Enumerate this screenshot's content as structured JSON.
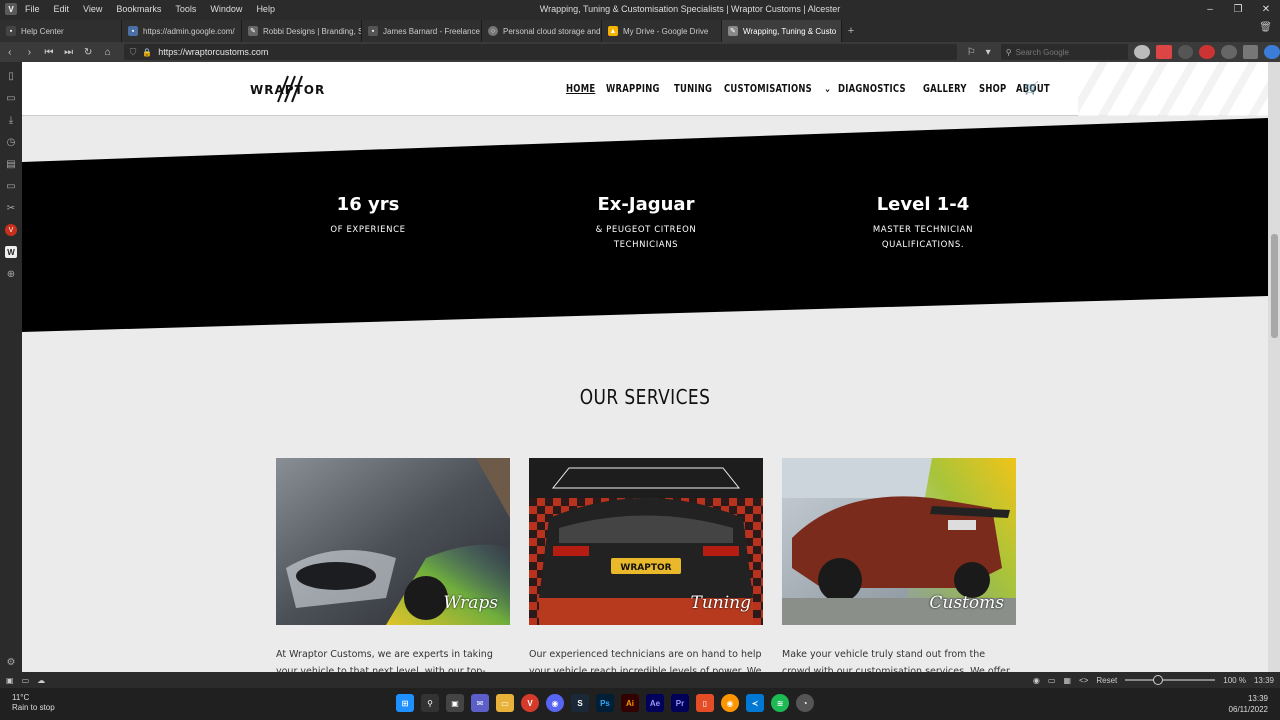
{
  "window": {
    "title": "Wrapping, Tuning & Customisation Specialists | Wraptor Customs | Alcester",
    "menu": [
      "File",
      "Edit",
      "View",
      "Bookmarks",
      "Tools",
      "Window",
      "Help"
    ]
  },
  "tabs": [
    {
      "label": "Help Center",
      "color": "#444444"
    },
    {
      "label": "https://admin.google.com/",
      "color": "#4a6fa5"
    },
    {
      "label": "Robbi Designs | Branding, S",
      "color": "#666666"
    },
    {
      "label": "James Barnard - Freelance",
      "color": "#555555"
    },
    {
      "label": "Personal cloud storage and",
      "color": "#777777"
    },
    {
      "label": "My Drive - Google Drive",
      "color": "#f4b400"
    },
    {
      "label": "Wrapping, Tuning & Custo",
      "color": "#888888",
      "active": true
    }
  ],
  "address": {
    "url": "https://wraptorcustoms.com",
    "search_placeholder": "Search Google"
  },
  "site": {
    "logo": "WRAPTOR",
    "nav": [
      "HOME",
      "WRAPPING",
      "TUNING",
      "CUSTOMISATIONS",
      "DIAGNOSTICS",
      "GALLERY",
      "SHOP",
      "ABOUT"
    ],
    "stats": [
      {
        "value": "16 yrs",
        "label": "OF EXPERIENCE"
      },
      {
        "value": "Ex-Jaguar",
        "label": "& PEUGEOT CITREON\nTECHNICIANS"
      },
      {
        "value": "Level 1-4",
        "label": "MASTER TECHNICIAN\nQUALIFICATIONS."
      }
    ],
    "services_title": "OUR SERVICES",
    "services": [
      {
        "label": "Wraps",
        "text": "At Wraptor Customs, we are experts in taking your vehicle to that next level, with our top-quality"
      },
      {
        "label": "Tuning",
        "text": "Our experienced technicians are on hand to help your vehicle reach incredible levels of power. We"
      },
      {
        "label": "Customs",
        "text": "Make your vehicle truly stand out from the crowd with our customisation services. We offer custom"
      }
    ]
  },
  "statusbar": {
    "reset": "Reset",
    "zoom": "100 %",
    "time": "13:39"
  },
  "taskbar": {
    "temperature": "11°C",
    "weather": "Rain to stop",
    "time": "13:39",
    "date": "06/11/2022"
  }
}
